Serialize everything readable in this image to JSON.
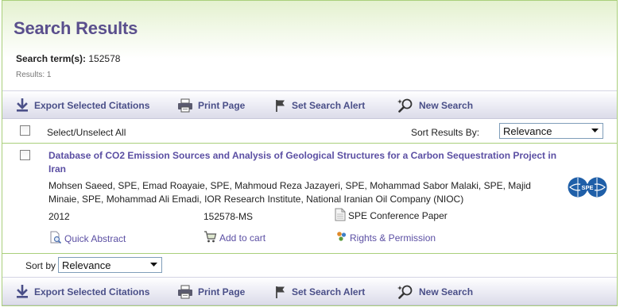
{
  "header": {
    "title": "Search Results",
    "search_term_label": "Search term(s):",
    "search_term_value": "152578",
    "results_count": "Results: 1"
  },
  "toolbar": {
    "export_label": "Export Selected Citations",
    "print_label": "Print Page",
    "alert_label": "Set Search Alert",
    "new_search_label": "New Search"
  },
  "selection": {
    "select_all_label": "Select/Unselect All",
    "sort_results_label": "Sort Results By:",
    "sort_value": "Relevance"
  },
  "result": {
    "title": "Database of CO2 Emission Sources and Analysis of Geological Structures for a Carbon Sequestration Project in Iran",
    "authors": "Mohsen Saeed, SPE, Emad Roayaie, SPE, Mahmoud Reza Jazayeri, SPE, Mohammad Sabor Malaki, SPE, Majid Minaie, SPE, Mohammad Ali Emadi, IOR Research Institute, National Iranian Oil Company (NIOC)",
    "year": "2012",
    "paper_id": "152578-MS",
    "type": "SPE Conference Paper",
    "quick_abstract_label": "Quick Abstract",
    "add_to_cart_label": "Add to cart",
    "rights_label": "Rights & Permission",
    "logo_text": "SPE"
  },
  "bottom_sort": {
    "label": "Sort by",
    "value": "Relevance"
  },
  "colors": {
    "title": "#5a4f8d",
    "link": "#5b4fa3",
    "border_green": "#a9cf7b",
    "toolbar_text": "#4a4f88",
    "logo_blue": "#1f5fa8"
  },
  "icons": {
    "export": "download-arrow-icon",
    "print": "printer-icon",
    "alert": "flag-icon",
    "new_search": "magnifier-sparkle-icon",
    "document": "document-icon",
    "quick_abstract": "document-search-icon",
    "cart": "cart-icon",
    "rights": "rights-icon"
  }
}
